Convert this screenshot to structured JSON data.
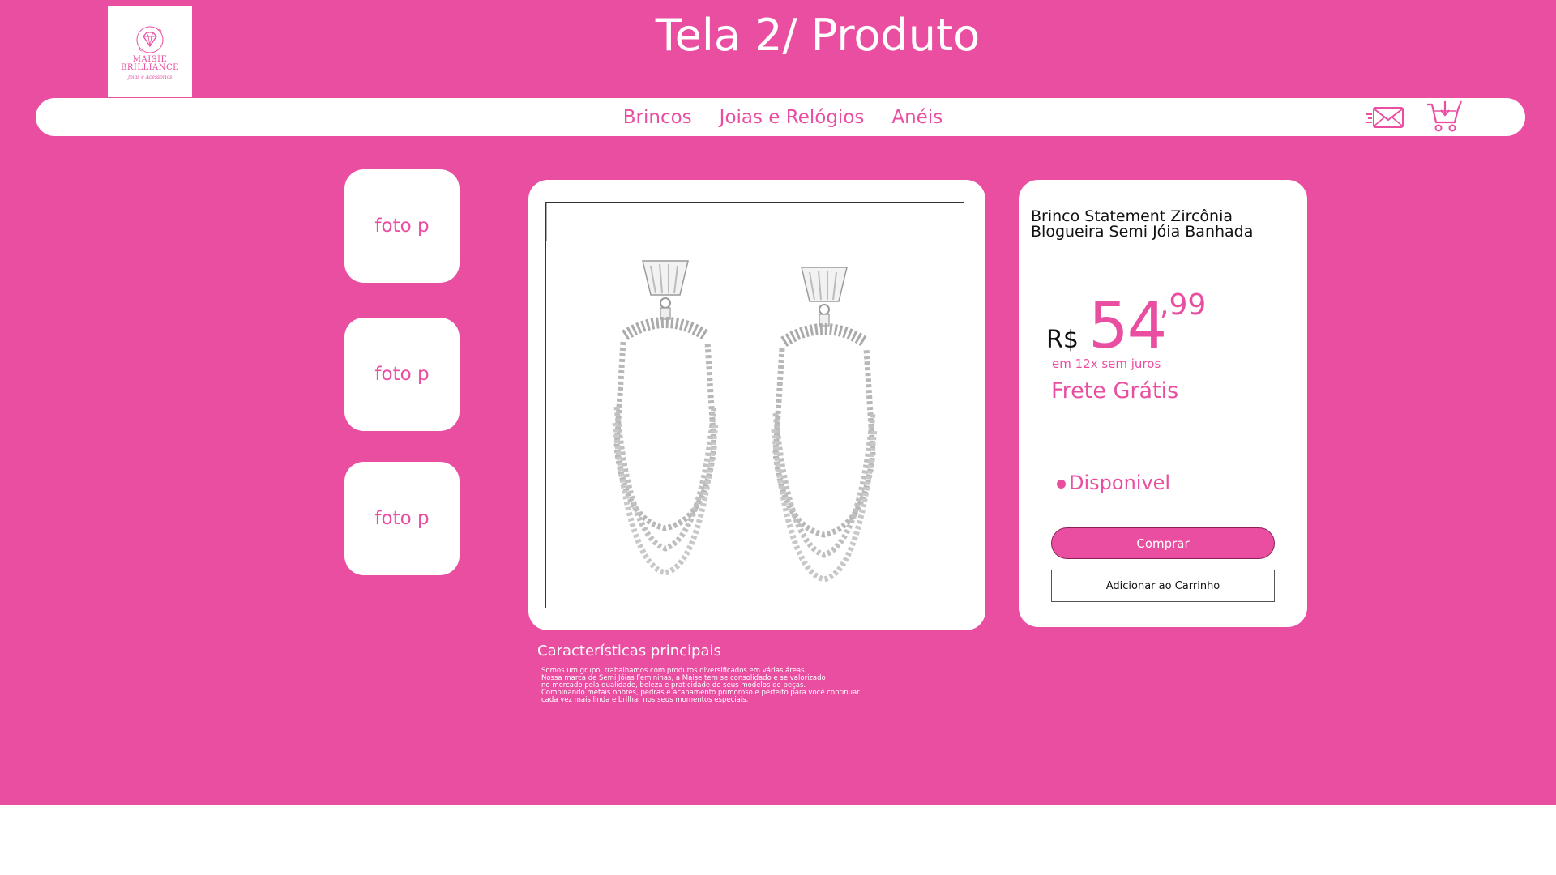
{
  "page": {
    "title": "Tela 2/ Produto"
  },
  "logo": {
    "brand_line1": "MAISIE",
    "brand_line2": "BRILLIANCE",
    "tagline": "Joias e Acessórios"
  },
  "nav": {
    "links": [
      "Brincos",
      "Joias e Relógios",
      "Anéis"
    ],
    "icons": [
      "mail-icon",
      "cart-download-icon"
    ]
  },
  "thumbnails": [
    "foto p",
    "foto p",
    "foto p"
  ],
  "product": {
    "name": "Brinco Statement Zircônia Blogueira Semi Jóia Banhada",
    "image_icon": "statement-earrings-photo",
    "price": {
      "currency": "R$",
      "integer": "54",
      "cents": ",99"
    },
    "installments": "em 12x sem juros",
    "shipping": "Frete Grátis",
    "stock_status": "Disponivel",
    "buy_label": "Comprar",
    "add_to_cart_label": "Adicionar ao Carrinho"
  },
  "features": {
    "title": "Características principais",
    "lines": [
      "Somos um grupo, trabalhamos com produtos diversificados em várias áreas.",
      "Nossa marca de Semi Jóias Femininas, a Maise tem se consolidado e se valorizado",
      "no mercado pela qualidade, beleza e praticidade de seus modelos de peças.",
      "Combinando metais nobres, pedras e acabamento primoroso e perfeito para você continuar",
      "cada vez mais linda e brilhar nos seus momentos especiais."
    ]
  },
  "colors": {
    "brand_pink": "#e94ea1",
    "card_white": "#ffffff",
    "bottom_white": "#ffffff"
  }
}
